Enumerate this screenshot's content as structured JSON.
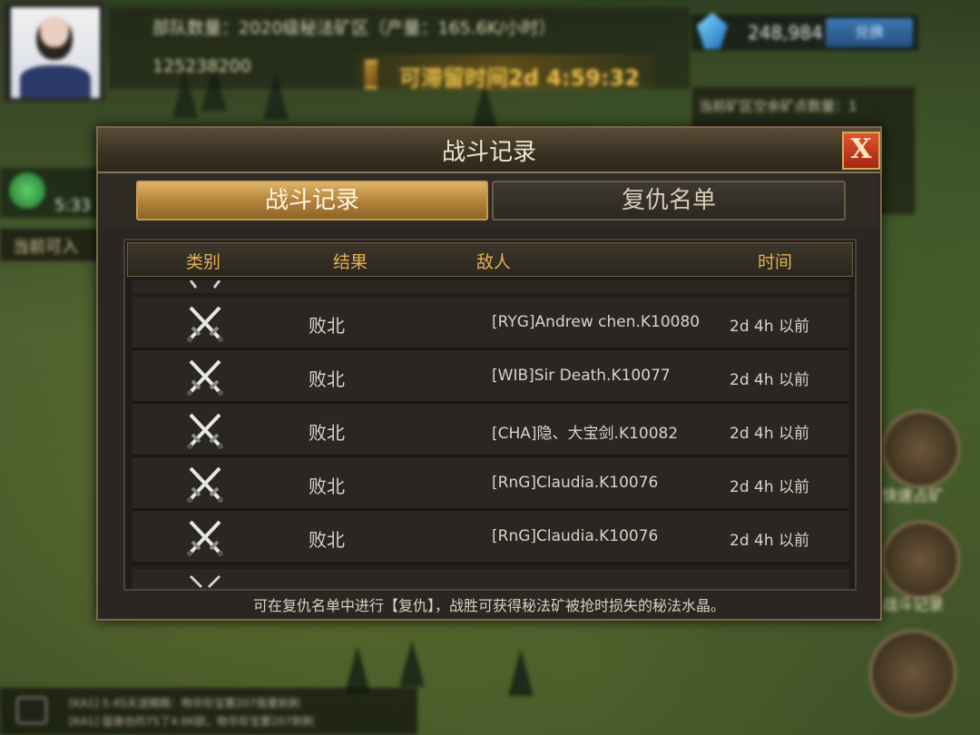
{
  "hud": {
    "team_data": "部队数量：2020级秘法矿区（产量：165.6K/小时）",
    "player_id": "125238200",
    "stay_time": "可滞留时间2d 4:59:32",
    "crystal_value": "248,984",
    "crystal_button": "兑换",
    "right_panel_text": "当前矿区空余矿点数量：1",
    "left_widget_time": "5:33",
    "left_banner": "当前可入",
    "button_speed_dig": "快速占矿",
    "button_battle_log": "战斗记录"
  },
  "chat": {
    "lines": [
      "[KA1] 5:45天涯赐赐：物华珍宝要207我要刺刺",
      "[KA1] 猛兽也的75了4.6K欧，物华珍宝要207刺刺"
    ]
  },
  "dialog": {
    "title": "战斗记录",
    "close_label": "X",
    "tabs": [
      {
        "label": "战斗记录",
        "active": true
      },
      {
        "label": "复仇名单",
        "active": false
      }
    ],
    "columns": {
      "type": "类别",
      "result": "结果",
      "enemy": "敌人",
      "time": "时间"
    },
    "rows": [
      {
        "icon": "crossed-swords-icon",
        "result": "败北",
        "enemy": "[RYG]Andrew chen.K10080",
        "time": "2d 4h 以前"
      },
      {
        "icon": "crossed-swords-icon",
        "result": "败北",
        "enemy": "[WIB]Sir Death.K10077",
        "time": "2d 4h 以前"
      },
      {
        "icon": "crossed-swords-icon",
        "result": "败北",
        "enemy": "[CHA]隐、大宝剑.K10082",
        "time": "2d 4h 以前"
      },
      {
        "icon": "crossed-swords-icon",
        "result": "败北",
        "enemy": "[RnG]Claudia.K10076",
        "time": "2d 4h 以前"
      },
      {
        "icon": "crossed-swords-icon",
        "result": "败北",
        "enemy": "[RnG]Claudia.K10076",
        "time": "2d 4h 以前"
      }
    ],
    "footer": "可在复仇名单中进行【复仇】，战胜可获得秘法矿被抢时损失的秘法水晶。"
  },
  "colors": {
    "active_tab": "#c08a3e",
    "header_text": "#e4b050",
    "close_button": "#c73a1a",
    "timer_text": "#f0c34a"
  }
}
